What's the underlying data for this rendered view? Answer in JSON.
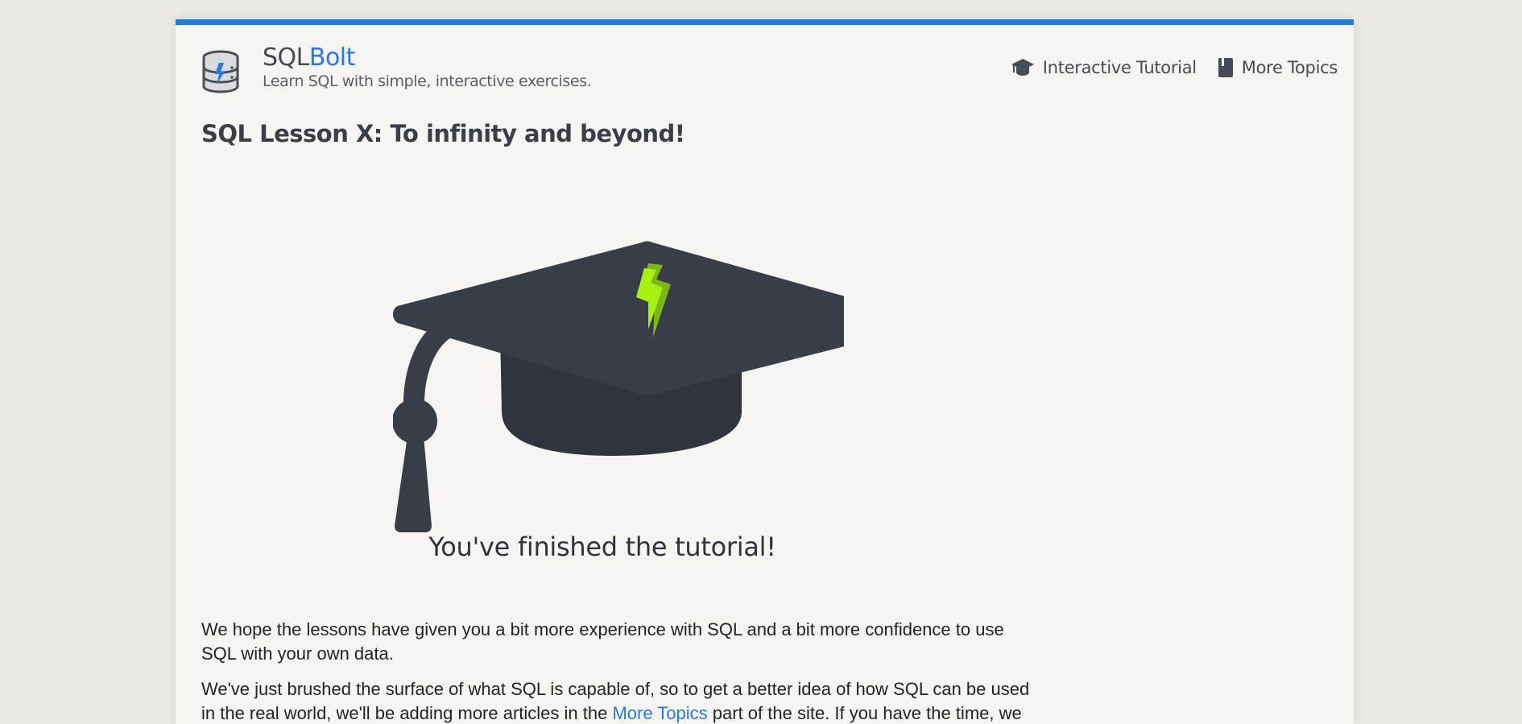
{
  "header": {
    "brand_prefix": "SQL",
    "brand_accent": "Bolt",
    "tagline": "Learn SQL with simple, interactive exercises.",
    "logo_icon": "database-bolt-icon"
  },
  "nav": {
    "items": [
      {
        "label": "Interactive Tutorial",
        "icon": "graduation-cap-icon"
      },
      {
        "label": "More Topics",
        "icon": "book-icon"
      }
    ]
  },
  "lesson": {
    "title": "SQL Lesson X: To infinity and beyond!",
    "finished": "You've finished the tutorial!",
    "para1": "We hope the lessons have given you a bit more experience with SQL and a bit more confidence to use SQL with your own data.",
    "para2_before": "We've just brushed the surface of what SQL is capable of, so to get a better idea of how SQL can be used in the real world, we'll be adding more articles in the ",
    "para2_link": "More Topics",
    "para2_after": " part of the site. If you have the time, we"
  },
  "colors": {
    "accent": "#2b78dc",
    "cap": "#393d48",
    "bolt": "#a5f212"
  }
}
